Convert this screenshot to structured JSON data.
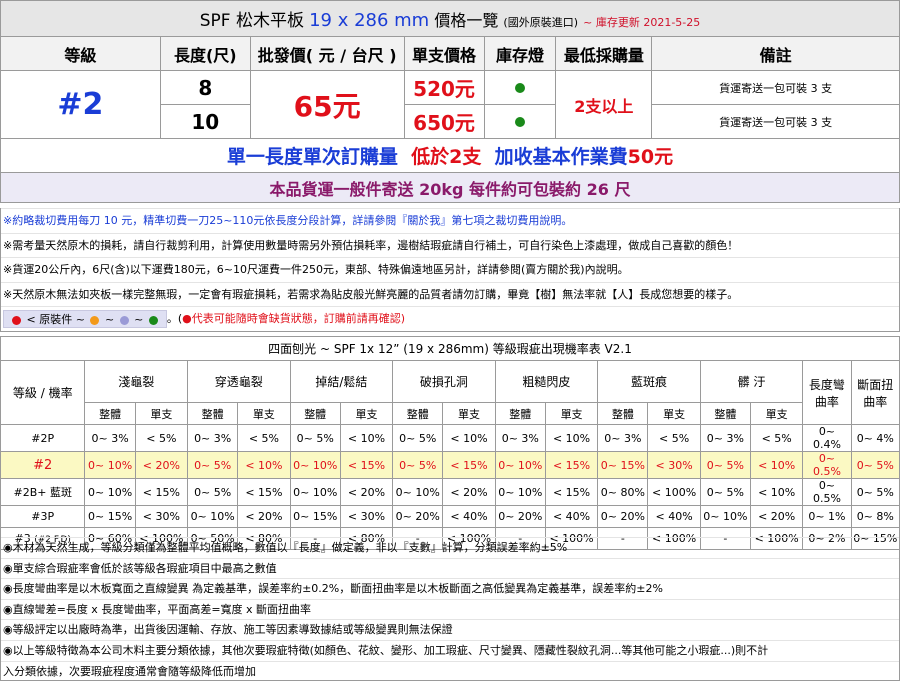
{
  "title": {
    "main": "SPF 松木平板",
    "size": "19 x 286 mm",
    "label": "價格一覽",
    "sub": "(國外原裝進口)",
    "updated": "~ 庫存更新 2021-5-25"
  },
  "headers": [
    "等級",
    "長度(尺)",
    "批發價( 元 / 台尺 )",
    "單支價格",
    "庫存燈",
    "最低採購量",
    "備註"
  ],
  "grade": "#2",
  "wholesale_price": "65元",
  "min_qty": "2支以上",
  "rows": [
    {
      "length": "8",
      "unit_price": "520元",
      "stock": "green",
      "note": "貨運寄送一包可裝 3 支"
    },
    {
      "length": "10",
      "unit_price": "650元",
      "stock": "green",
      "note": "貨運寄送一包可裝 3 支"
    }
  ],
  "banner1": {
    "a": "單一長度單次訂購量",
    "b": "低於2支",
    "c": "加收基本作業費",
    "d": "50元"
  },
  "banner2": "本品貨運一般件寄送 20kg 每件約可包裝約 26 尺",
  "notes": [
    "※約略裁切費用每刀 10 元，精準切費一刀25~110元依長度分段計算，詳請參閱『關於我』第七項之裁切費用說明。",
    "※需考量天然原木的損耗，請自行裁剪利用，計算使用數量時需另外預估損耗率，邊樹結瑕疵請自行補土，可自行染色上漆處理，做成自己喜歡的顏色！",
    "※貨運20公斤內，6尺(含)以下運費180元，6~10尺運費一件250元，東部、特殊偏遠地區另計，詳請參閱(賣方關於我)內說明。",
    "※天然原木無法如夾板一樣完整無瑕，一定會有瑕疵損耗，若需求為貼皮般光鮮亮麗的品質者請勿訂購，畢竟【樹】無法率就【人】長成您想要的樣子。"
  ],
  "legend": {
    "label": "< 原裝件",
    "tilde": "~",
    "colors": [
      "#e0101a",
      "#f39a1a",
      "#9a9ad6",
      "#1a8a1a"
    ],
    "tail": "。(",
    "warning": "●代表可能隨時會缺貨狀態，訂購前請再確認)"
  },
  "defect": {
    "title": "四面刨光 ~ SPF 1x 12”  (19 x 286mm) 等級瑕疵出現機率表 V2.1",
    "corner": "等級 / 機率",
    "groups": [
      "淺龜裂",
      "穿透龜裂",
      "掉結/鬆結",
      "破損孔洞",
      "粗糙閃皮",
      "藍斑痕",
      "髒 汙",
      "長度彎曲率",
      "斷面扭曲率"
    ],
    "subheaders": [
      "整體",
      "單支"
    ],
    "rows": [
      {
        "grade": "#2P",
        "cells": [
          "0~ 3%",
          "< 5%",
          "0~ 3%",
          "< 5%",
          "0~ 5%",
          "< 10%",
          "0~ 5%",
          "< 10%",
          "0~ 3%",
          "< 10%",
          "0~ 3%",
          "< 5%",
          "0~ 3%",
          "< 5%",
          "0~ 0.4%",
          "0~ 4%"
        ]
      },
      {
        "grade": "#2",
        "cells": [
          "0~ 10%",
          "< 20%",
          "0~ 5%",
          "< 10%",
          "0~ 10%",
          "< 15%",
          "0~ 5%",
          "< 15%",
          "0~ 10%",
          "< 15%",
          "0~ 15%",
          "< 30%",
          "0~ 5%",
          "< 10%",
          "0~ 0.5%",
          "0~ 5%"
        ]
      },
      {
        "grade": "#2B+ 藍斑",
        "cells": [
          "0~ 10%",
          "< 15%",
          "0~ 5%",
          "< 15%",
          "0~ 10%",
          "< 20%",
          "0~ 10%",
          "< 20%",
          "0~ 10%",
          "< 15%",
          "0~ 80%",
          "< 100%",
          "0~ 5%",
          "< 10%",
          "0~ 0.5%",
          "0~ 5%"
        ]
      },
      {
        "grade": "#3P",
        "cells": [
          "0~ 15%",
          "< 30%",
          "0~ 10%",
          "< 20%",
          "0~ 15%",
          "< 30%",
          "0~ 20%",
          "< 40%",
          "0~ 20%",
          "< 40%",
          "0~ 20%",
          "< 40%",
          "0~ 10%",
          "< 20%",
          "0~ 1%",
          "0~ 8%"
        ]
      },
      {
        "grade": "#3",
        "grade_sub": "(#2 F.D)",
        "cells": [
          "0~ 60%",
          "< 100%",
          "0~ 50%",
          "< 80%",
          "-",
          "< 80%",
          "-",
          "< 100%",
          "-",
          "< 100%",
          "-",
          "< 100%",
          "-",
          "< 100%",
          "0~ 2%",
          "0~ 15%"
        ]
      }
    ]
  },
  "footnotes": [
    "◉木材為天然生成，等級分類僅為整體平均值概略，數值以『長度』做定義，非以『支數』計算，分類誤差率約±5%",
    "◉單支綜合瑕疵率會低於該等級各瑕疵項目中最高之數值",
    "◉長度彎曲率是以木板寬面之直線變異 為定義基準，誤差率約±0.2%，斷面扭曲率是以木板斷面之高低變異為定義基準，誤差率約±2%",
    "◉直線彎差=長度 x 長度彎曲率，平面高差=寬度 x 斷面扭曲率",
    "◉等級評定以出廠時為準，出貨後因運輸、存放、施工等因素導致據結或等級變異則無法保證",
    "◉以上等級特徵為本公司木料主要分類依據，其他次要瑕疵特徵(如顏色、花紋、變形、加工瑕疵、尺寸變異、隱藏性裂紋孔洞...等其他可能之小瑕疵...)則不計",
    "入分類依據，次要瑕疵程度通常會隨等級降低而增加"
  ]
}
